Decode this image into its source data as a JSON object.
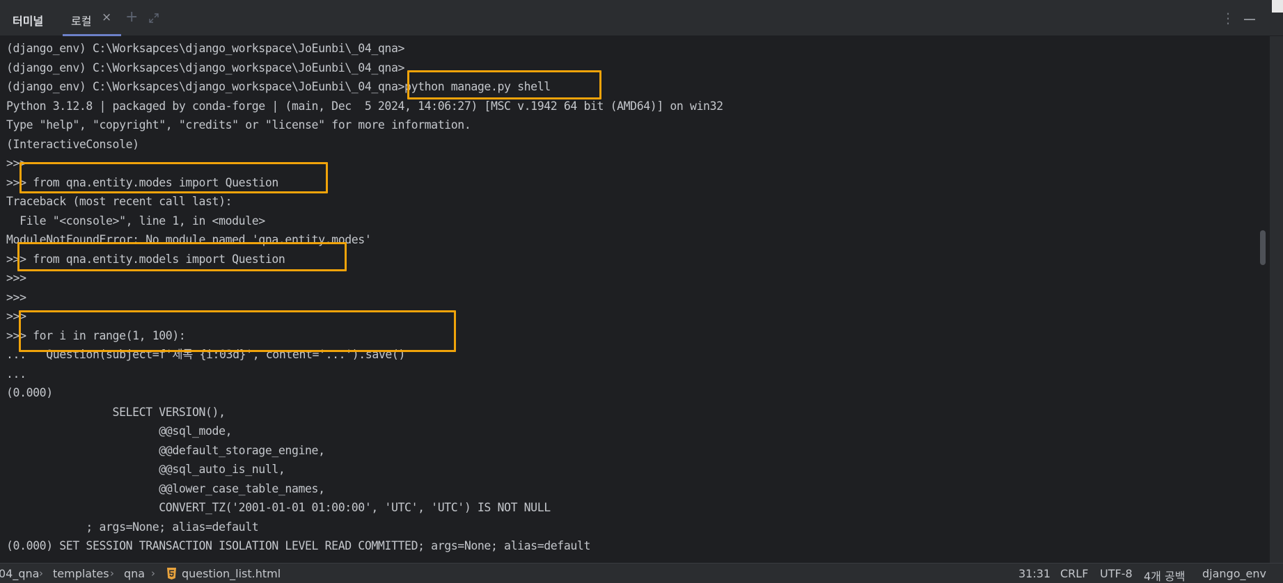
{
  "tabbar": {
    "title": "터미널",
    "tab_label": "로컬",
    "close_glyph": "×",
    "plus_glyph": "+",
    "more_glyph": "⋮",
    "accent_color": "#6d81c9"
  },
  "terminal": {
    "lines": [
      "(django_env) C:\\Worksapces\\django_workspace\\JoEunbi\\_04_qna>",
      "(django_env) C:\\Worksapces\\django_workspace\\JoEunbi\\_04_qna>",
      "(django_env) C:\\Worksapces\\django_workspace\\JoEunbi\\_04_qna>python manage.py shell",
      "Python 3.12.8 | packaged by conda-forge | (main, Dec  5 2024, 14:06:27) [MSC v.1942 64 bit (AMD64)] on win32",
      "Type \"help\", \"copyright\", \"credits\" or \"license\" for more information.",
      "(InteractiveConsole)",
      ">>>",
      ">>> from qna.entity.modes import Question",
      "Traceback (most recent call last):",
      "  File \"<console>\", line 1, in <module>",
      "ModuleNotFoundError: No module named 'qna.entity.modes'",
      ">>> from qna.entity.models import Question",
      ">>>",
      ">>>",
      ">>>",
      ">>> for i in range(1, 100):",
      "...   Question(subject=f'제목 {i:03d}', content='...').save()",
      "...",
      "(0.000)",
      "                SELECT VERSION(),",
      "                       @@sql_mode,",
      "                       @@default_storage_engine,",
      "                       @@sql_auto_is_null,",
      "                       @@lower_case_table_names,",
      "                       CONVERT_TZ('2001-01-01 01:00:00', 'UTC', 'UTC') IS NOT NULL",
      "            ; args=None; alias=default",
      "(0.000) SET SESSION TRANSACTION ISOLATION LEVEL READ COMMITTED; args=None; alias=default"
    ],
    "highlight_color": "#f0a30a",
    "text_color": "#c4c7cc",
    "background": "#1e1f22"
  },
  "statusbar": {
    "breadcrumbs": [
      "04_qna",
      "templates",
      "qna",
      "question_list.html"
    ],
    "file_icon": "html5-icon",
    "cursor_position": "31:31",
    "line_ending": "CRLF",
    "encoding": "UTF-8",
    "indent": "4개 공백",
    "interpreter": "django_env"
  }
}
